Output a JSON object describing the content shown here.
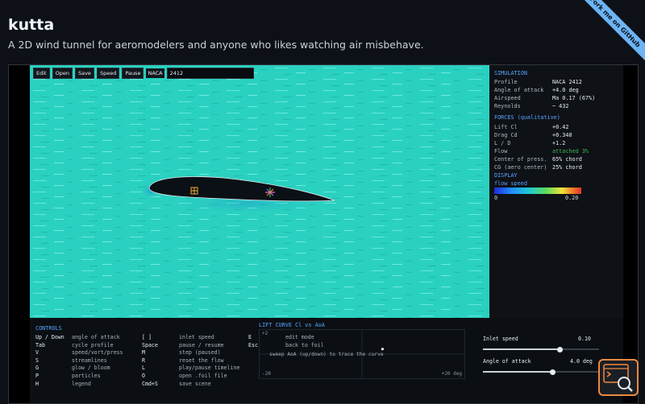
{
  "header": {
    "title": "kutta",
    "subtitle": "A 2D wind tunnel for aeromodelers and anyone who likes watching air misbehave.",
    "ribbon": "Fork me on GitHub"
  },
  "toolbar": {
    "buttons": [
      "Edit",
      "Open",
      "Save",
      "Speed",
      "Pause"
    ],
    "naca_label": "NACA",
    "naca_value": "2412"
  },
  "panel": {
    "simulation_title": "SIMULATION",
    "simulation": [
      {
        "k": "Profile",
        "v": "NACA 2412"
      },
      {
        "k": "Angle of attack",
        "v": "+4.0 deg"
      },
      {
        "k": "Airspeed",
        "v": "Ma 0.17  (67%)"
      },
      {
        "k": "Reynolds",
        "v": "~ 432"
      }
    ],
    "forces_title": "FORCES (qualitative)",
    "forces": [
      {
        "k": "Lift  Cl",
        "v": "+0.42"
      },
      {
        "k": "Drag  Cd",
        "v": "+0.340"
      },
      {
        "k": "L / D",
        "v": "+1.2"
      },
      {
        "k": "Flow",
        "v": "attached 3%"
      },
      {
        "k": "Center of press.",
        "v": "65% chord"
      },
      {
        "k": "CG (aero center)",
        "v": "25% chord"
      }
    ],
    "display_title": "DISPLAY",
    "colorbar_label": "flow speed",
    "colorbar_min": "0",
    "colorbar_max": "0.20",
    "colors": {
      "accent": "#58a6ff",
      "attached": "#3fb950",
      "fluid": "#2ad1c0"
    }
  },
  "controls": {
    "title": "CONTROLS",
    "col1": [
      {
        "key": "Up / Down",
        "desc": "angle of attack"
      },
      {
        "key": "Tab",
        "desc": "cycle profile"
      },
      {
        "key": "V",
        "desc": "speed/vort/press"
      },
      {
        "key": "S",
        "desc": "streamlines"
      },
      {
        "key": "G",
        "desc": "glow / bloom"
      },
      {
        "key": "P",
        "desc": "particles"
      },
      {
        "key": "H",
        "desc": "legend"
      }
    ],
    "col2": [
      {
        "key": "[  ]",
        "desc": "inlet speed"
      },
      {
        "key": "Space",
        "desc": "pause / resume"
      },
      {
        "key": "M",
        "desc": "step (paused)"
      },
      {
        "key": "R",
        "desc": "reset the flow"
      },
      {
        "key": "L",
        "desc": "play/pause timeline"
      },
      {
        "key": "O",
        "desc": "open .foil file"
      },
      {
        "key": "Cmd+S",
        "desc": "save scene"
      }
    ],
    "col3": [
      {
        "key": "E",
        "desc": "edit mode"
      },
      {
        "key": "Esc",
        "desc": "back to foil"
      }
    ]
  },
  "lift_curve": {
    "title": "LIFT CURVE  Cl vs AoA",
    "y_top": "+2",
    "hint": "sweep AoA (up/down) to trace the curve",
    "x_min": "-20",
    "x_max": "+20 deg",
    "point": {
      "aoa": 4.0,
      "cl": 0.42
    }
  },
  "sliders": [
    {
      "label": "Inlet speed",
      "value": "0.10",
      "fraction": 0.66
    },
    {
      "label": "Angle of attack",
      "value": "4.0 deg",
      "fraction": 0.6
    }
  ]
}
